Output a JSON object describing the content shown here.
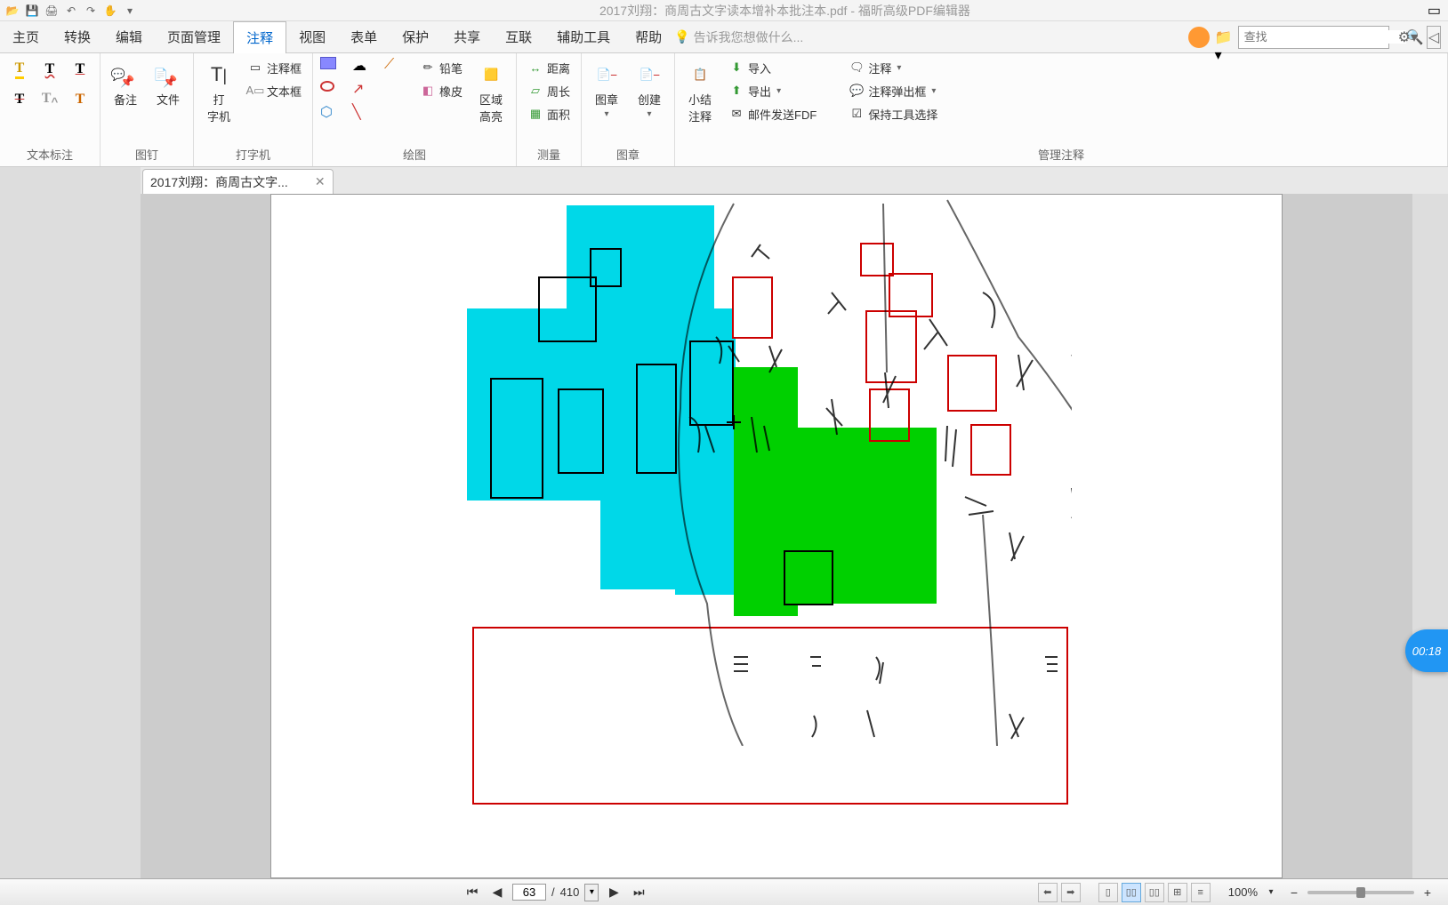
{
  "title": {
    "document_name": "2017刘翔：商周古文字读本增补本批注本.pdf",
    "app_name": "福昕高级PDF编辑器",
    "separator": " - "
  },
  "menu": {
    "items": [
      "主页",
      "转换",
      "编辑",
      "页面管理",
      "注释",
      "视图",
      "表单",
      "保护",
      "共享",
      "互联",
      "辅助工具",
      "帮助"
    ],
    "active_index": 4,
    "tell_me": "告诉我您想做什么..."
  },
  "search": {
    "placeholder": "查找"
  },
  "ribbon": {
    "groups": {
      "text_markup": {
        "label": "文本标注"
      },
      "pins": {
        "label": "图钉",
        "note": "备注",
        "file": "文件"
      },
      "typewriter": {
        "label": "打字机",
        "typewriter": "打\n字机",
        "callout": "注释框",
        "textbox": "文本框"
      },
      "drawing": {
        "label": "绘图",
        "pencil": "铅笔",
        "eraser": "橡皮",
        "area": "区域\n高亮"
      },
      "measure": {
        "label": "测量",
        "distance": "距离",
        "perimeter": "周长",
        "area": "面积"
      },
      "stamp": {
        "label": "图章",
        "stamp": "图章",
        "create": "创建"
      },
      "manage": {
        "label": "管理注释",
        "summary": "小结\n注释",
        "import": "导入",
        "export": "导出",
        "email": "邮件发送FDF",
        "comments": "注释",
        "popup": "注释弹出框",
        "keeptool": "保持工具选择"
      }
    }
  },
  "tab": {
    "label": "2017刘翔：商周古文字..."
  },
  "status": {
    "current_page": "63",
    "total_sep": "/",
    "total_pages": "410",
    "zoom": "100%"
  },
  "timer": {
    "text": "00:18"
  }
}
